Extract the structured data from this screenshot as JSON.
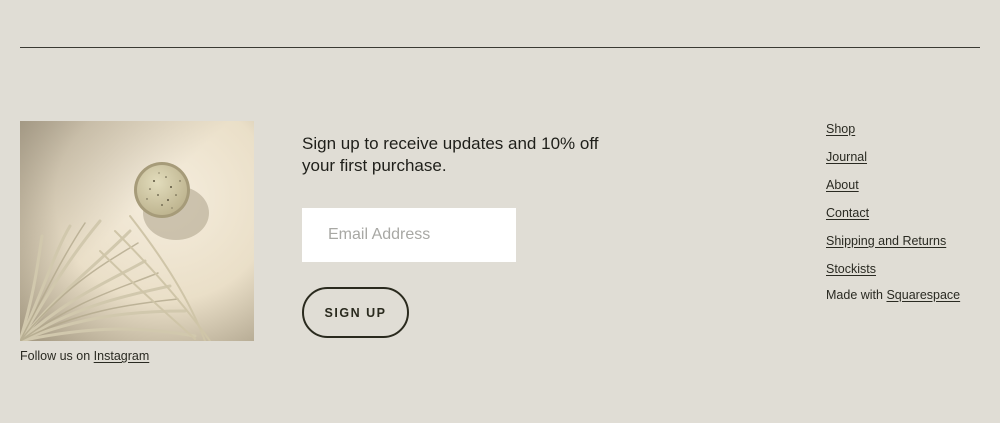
{
  "footer": {
    "follow": {
      "prefix": "Follow us on",
      "link": "Instagram"
    },
    "newsletter": {
      "headline": "Sign up to receive updates and 10% off your first purchase.",
      "email_placeholder": "Email Address",
      "button_label": "SIGN UP"
    },
    "nav": [
      "Shop",
      "Journal",
      "About",
      "Contact",
      "Shipping and Returns",
      "Stockists"
    ],
    "made_with": {
      "prefix": "Made with",
      "link": "Squarespace"
    }
  },
  "colors": {
    "background": "#e0ddd5",
    "text": "#2a2a22",
    "button_border": "#2a2a1e",
    "input_bg": "#ffffff"
  }
}
